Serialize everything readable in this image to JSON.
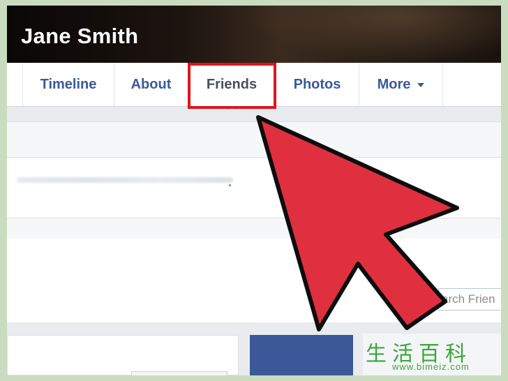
{
  "profile": {
    "name": "Jane Smith"
  },
  "tabs": {
    "timeline": "Timeline",
    "about": "About",
    "friends": "Friends",
    "photos": "Photos",
    "more": "More"
  },
  "search": {
    "value": "arch Frien"
  },
  "watermark": {
    "chars": "生活百科",
    "url": "www.bimeiz.com"
  },
  "colors": {
    "brand": "#3b5998",
    "highlight": "#e0141f",
    "arrow": "#e03040"
  }
}
